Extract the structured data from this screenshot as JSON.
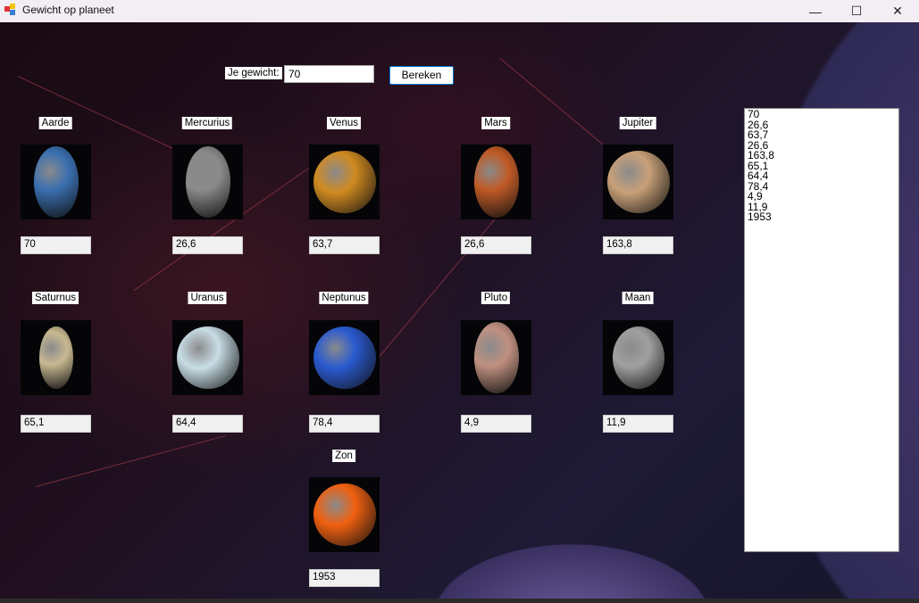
{
  "window": {
    "title": "Gewicht op planeet",
    "minimize": "—",
    "maximize": "☐",
    "close": "✕"
  },
  "form": {
    "weight_label": "Je gewicht:",
    "weight_value": "70",
    "calculate_button": "Bereken"
  },
  "planets": [
    {
      "name": "Aarde",
      "weight": "70",
      "color": "#3a6fb0"
    },
    {
      "name": "Mercurius",
      "weight": "26,6",
      "color": "#8a8a8a"
    },
    {
      "name": "Venus",
      "weight": "63,7",
      "color": "#d08a20"
    },
    {
      "name": "Mars",
      "weight": "26,6",
      "color": "#c05a25"
    },
    {
      "name": "Jupiter",
      "weight": "163,8",
      "color": "#c8a078"
    },
    {
      "name": "Saturnus",
      "weight": "65,1",
      "color": "#c8b890"
    },
    {
      "name": "Uranus",
      "weight": "64,4",
      "color": "#c8dde5"
    },
    {
      "name": "Neptunus",
      "weight": "78,4",
      "color": "#2a5ad0"
    },
    {
      "name": "Pluto",
      "weight": "4,9",
      "color": "#c09080"
    },
    {
      "name": "Maan",
      "weight": "11,9",
      "color": "#a0a0a0"
    },
    {
      "name": "Zon",
      "weight": "1953",
      "color": "#f06010"
    }
  ],
  "results": [
    "70",
    "26,6",
    "63,7",
    "26,6",
    "163,8",
    "65,1",
    "64,4",
    "78,4",
    "4,9",
    "11,9",
    "1953"
  ]
}
